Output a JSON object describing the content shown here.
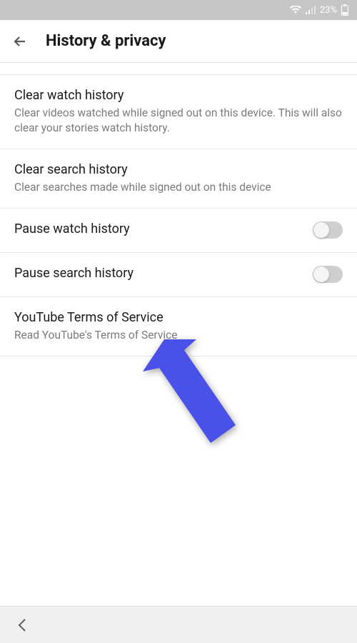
{
  "status": {
    "battery_pct": "23%"
  },
  "header": {
    "title": "History & privacy"
  },
  "items": [
    {
      "title": "Clear watch history",
      "subtitle": "Clear videos watched while signed out on this device. This will also clear your stories watch history."
    },
    {
      "title": "Clear search history",
      "subtitle": "Clear searches made while signed out on this device"
    },
    {
      "title": "Pause watch history"
    },
    {
      "title": "Pause search history"
    },
    {
      "title": "YouTube Terms of Service",
      "subtitle": "Read YouTube's Terms of Service"
    }
  ]
}
